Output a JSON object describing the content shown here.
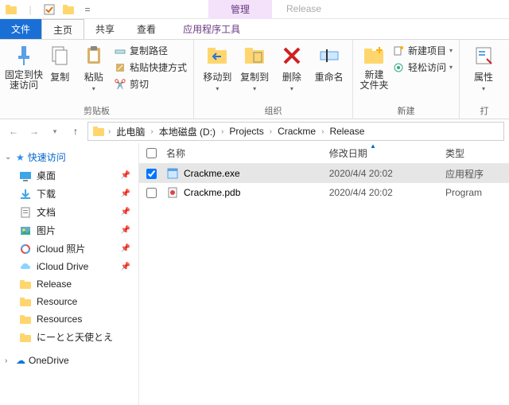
{
  "titlebar": {
    "contextual_label": "管理",
    "window_title": "Release"
  },
  "tabs": {
    "file": "文件",
    "home": "主页",
    "share": "共享",
    "view": "查看",
    "app_tools": "应用程序工具"
  },
  "ribbon": {
    "clipboard": {
      "pin": "固定到快\n速访问",
      "copy": "复制",
      "paste": "粘贴",
      "copy_path": "复制路径",
      "paste_shortcut": "粘贴快捷方式",
      "cut": "剪切",
      "group": "剪贴板"
    },
    "organize": {
      "move_to": "移动到",
      "copy_to": "复制到",
      "delete": "删除",
      "rename": "重命名",
      "group": "组织"
    },
    "new_": {
      "new_folder": "新建\n文件夹",
      "new_item": "新建项目",
      "easy_access": "轻松访问",
      "group": "新建"
    },
    "open": {
      "properties": "属性",
      "group": "打"
    }
  },
  "breadcrumb": {
    "items": [
      "此电脑",
      "本地磁盘 (D:)",
      "Projects",
      "Crackme",
      "Release"
    ]
  },
  "columns": {
    "name": "名称",
    "date": "修改日期",
    "type": "类型"
  },
  "sidebar": {
    "quick_access": "快速访问",
    "items": [
      {
        "label": "桌面",
        "icon": "desktop",
        "pinned": true
      },
      {
        "label": "下载",
        "icon": "download",
        "pinned": true
      },
      {
        "label": "文档",
        "icon": "document",
        "pinned": true
      },
      {
        "label": "图片",
        "icon": "picture",
        "pinned": true
      },
      {
        "label": "iCloud 照片",
        "icon": "icloud-photo",
        "pinned": true
      },
      {
        "label": "iCloud Drive",
        "icon": "icloud",
        "pinned": true
      },
      {
        "label": "Release",
        "icon": "folder",
        "pinned": false
      },
      {
        "label": "Resource",
        "icon": "folder",
        "pinned": false
      },
      {
        "label": "Resources",
        "icon": "folder",
        "pinned": false
      },
      {
        "label": "にーとと天使とえ",
        "icon": "folder",
        "pinned": false
      }
    ],
    "onedrive": "OneDrive"
  },
  "files": [
    {
      "name": "Crackme.exe",
      "date": "2020/4/4 20:02",
      "type": "应用程序",
      "icon": "exe",
      "selected": true,
      "checked": true
    },
    {
      "name": "Crackme.pdb",
      "date": "2020/4/4 20:02",
      "type": "Program",
      "icon": "pdb",
      "selected": false,
      "checked": false
    }
  ]
}
